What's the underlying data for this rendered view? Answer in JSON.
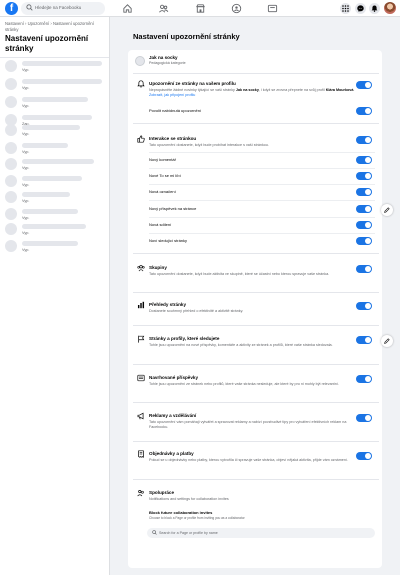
{
  "topbar": {
    "search_placeholder": "Hledejte na Facebooku",
    "logo_letter": "f"
  },
  "sidebar": {
    "breadcrumb": "Nastavení › Upozornění › Nastavení upozornění stránky",
    "title": "Nastavení upozornění stránky",
    "item_sublabel": "Vyp.",
    "item_sublabel_alt": "Zap."
  },
  "main": {
    "heading": "Nastavení upozornění stránky",
    "profile": {
      "name": "Jak na socky",
      "role": "Pedagogická kategorie"
    },
    "sections": {
      "profile_notifs": {
        "title": "Upozornění ze stránky na vašem profilu",
        "desc_before": "Nepropásněte žádné novinky týkající se vaší stránky ",
        "desc_page": "Jak na socky",
        "desc_middle": ", i když se zrovna přepnete na svůj profil ",
        "desc_person": "Klára Mourková",
        "desc_after": ". ",
        "desc_link": "Zobrazit, jak připojení profilu",
        "row": "Povolit nabídnutá upozornění"
      },
      "interactions": {
        "title": "Interakce se stránkou",
        "desc": "Tato upozornění dostanete, když bude probíhat interakce s vaší stránkou.",
        "rows": [
          "Nový komentář",
          "Nové To se mi líbí",
          "Nová označení",
          "Nový příspěvek na stránce",
          "Nová sdílení",
          "Noví sledující stránky"
        ]
      },
      "groups": {
        "title": "Skupiny",
        "desc": "Tato upozornění dostanete, když bude aktivita ve skupině, které se účastní nebo kterou spravuje vaše stránka."
      },
      "overview": {
        "title": "Přehledy stránky",
        "desc": "Dostanete souhrnný přehled o efektivitě a aktivitě stránky."
      },
      "followed": {
        "title": "Stránky a profily, které sledujete",
        "desc": "Tohle jsou upozornění na nové příspěvky, komentáře a aktivity ze stránek a profilů, které vaše stránka sledovala."
      },
      "suggested": {
        "title": "Navrhované příspěvky",
        "desc": "Tohle jsou upozornění ze stránek nebo profilů, které vaše stránka nesleduje, ale které by pro ni mohly být relevantní."
      },
      "ads": {
        "title": "Reklamy a vzdělávání",
        "desc": "Tato upozornění vám pomáhají vytvářet a spravovat reklamy a nabízí povzbudivé tipy pro vytváření efektivních reklam na Facebooku."
      },
      "orders": {
        "title": "Objednávky a platby",
        "desc": "Pokud se u objednávky nebo platby, kterou vytvořila či spravuje vaše stránka, objeví nějaká aktivita, přijde vám oznámení."
      },
      "collab": {
        "title": "Spolupráce",
        "desc": "Notifications and settings for collaboration invites",
        "block_title": "Block future collaboration invites",
        "block_desc": "Choose to block a Page or profile from inviting you as a collaborator",
        "search_placeholder": "Search for a Page or profile by name"
      }
    }
  },
  "colors": {
    "accent": "#1b74e4",
    "brand": "#1877f2",
    "background": "#f0f2f5"
  }
}
